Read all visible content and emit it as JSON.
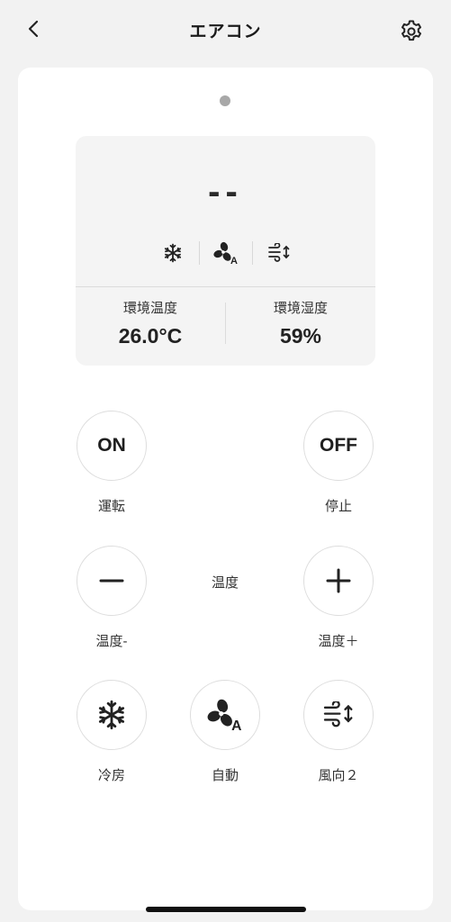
{
  "header": {
    "title": "エアコン",
    "back_icon": "chevron-left-icon",
    "settings_icon": "gear-icon"
  },
  "status": {
    "setpoint": "--",
    "mode_icons": [
      "snowflake-icon",
      "fan-auto-icon",
      "swing-icon"
    ],
    "ambient_temp_label": "環境温度",
    "ambient_temp_value": "26.0°C",
    "ambient_humidity_label": "環境湿度",
    "ambient_humidity_value": "59%"
  },
  "controls": {
    "on_text": "ON",
    "on_label": "運転",
    "off_text": "OFF",
    "off_label": "停止",
    "temp_title": "温度",
    "temp_down_label": "温度-",
    "temp_up_label": "温度＋",
    "cool_label": "冷房",
    "auto_label": "自動",
    "swing_label": "風向２"
  },
  "colors": {
    "background": "#f2f2f2",
    "card": "#ffffff",
    "panel": "#f4f4f4",
    "text": "#222222",
    "border": "#dddddd"
  }
}
